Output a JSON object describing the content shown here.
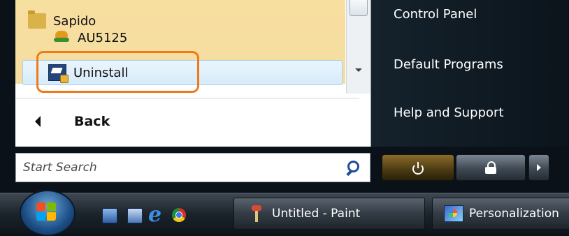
{
  "programs": {
    "items": [
      {
        "label": "Sapido",
        "icon": "folder-icon"
      },
      {
        "label": "AU5125",
        "icon": "au5125-icon"
      },
      {
        "label": "Uninstall",
        "icon": "uninstall-icon"
      }
    ],
    "back_label": "Back"
  },
  "search": {
    "placeholder": "Start Search"
  },
  "right_menu": {
    "items": [
      "Control Panel",
      "Default Programs",
      "Help and Support"
    ]
  },
  "taskbar": {
    "quick_launch": [
      "show-desktop-icon",
      "switch-windows-icon",
      "internet-explorer-icon",
      "chrome-icon"
    ],
    "buttons": [
      {
        "label": "Untitled - Paint",
        "icon": "paint-icon"
      },
      {
        "label": "Personalization",
        "icon": "personalization-icon"
      }
    ]
  },
  "colors": {
    "highlight_outline": "#f07a1a",
    "selected_row": "#d6ebfa",
    "recent_programs": "#f7dfa0",
    "power_button": "#4f3e14"
  }
}
